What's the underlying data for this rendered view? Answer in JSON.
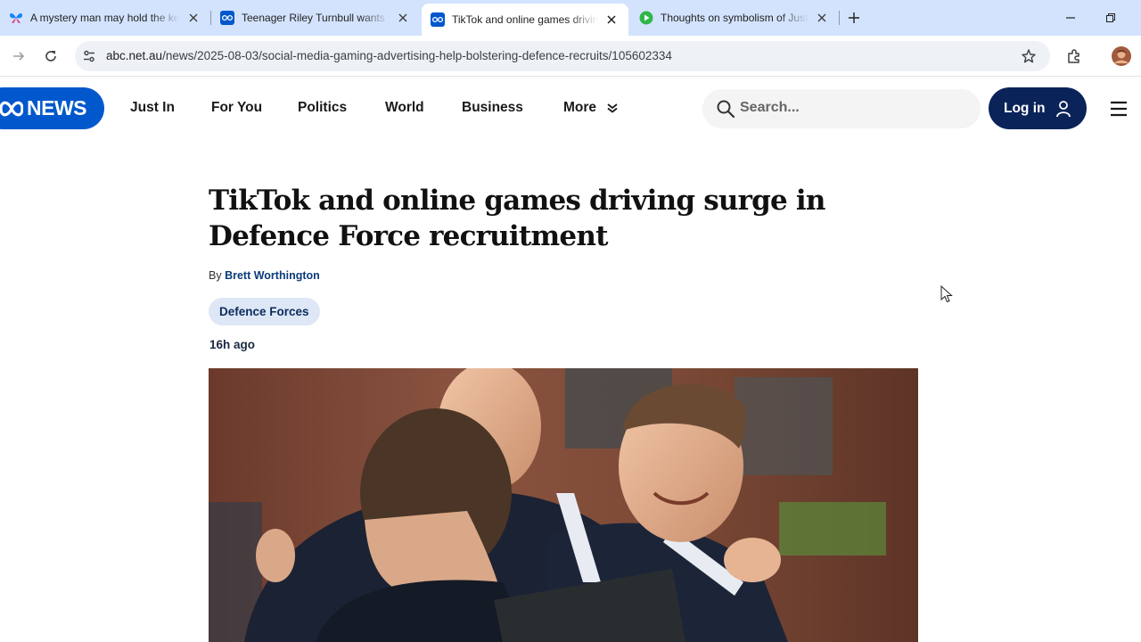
{
  "browser": {
    "tabs": [
      {
        "title": "A mystery man may hold the key",
        "favicon": "butterfly-icon",
        "active": false
      },
      {
        "title": "Teenager Riley Turnbull wants you",
        "favicon": "abc-icon",
        "active": false
      },
      {
        "title": "TikTok and online games driving surge",
        "favicon": "abc-icon",
        "active": true
      },
      {
        "title": "Thoughts on symbolism of Justice",
        "favicon": "play-icon",
        "active": false
      }
    ],
    "url_host": "abc.net.au",
    "url_path": "/news/2025-08-03/social-media-gaming-advertising-help-bolstering-defence-recruits/105602334"
  },
  "site": {
    "logo": "NEWS",
    "nav": [
      "Just In",
      "For You",
      "Politics",
      "World",
      "Business",
      "More"
    ],
    "search_placeholder": "Search...",
    "login_label": "Log in"
  },
  "article": {
    "headline": "TikTok and online games driving surge in Defence Force recruitment",
    "byline_prefix": "By",
    "author": "Brett Worthington",
    "topic": "Defence Forces",
    "timestamp": "16h ago"
  },
  "colors": {
    "tabstrip": "#d3e3fd",
    "abc_blue": "#0058cc",
    "login_navy": "#0a2459",
    "chip_bg": "#dde7f6"
  }
}
